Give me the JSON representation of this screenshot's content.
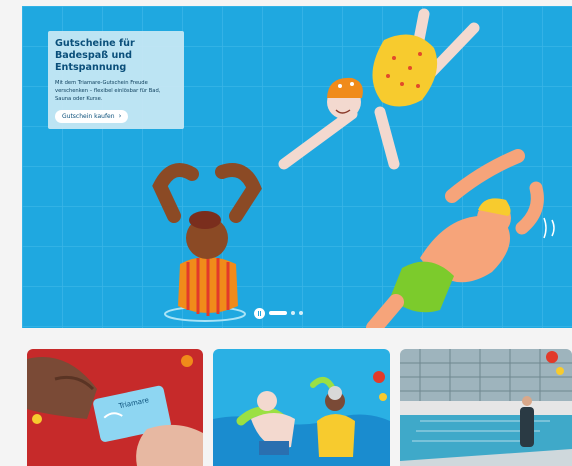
{
  "hero": {
    "title": "Gutscheine für Badespaß und Entspannung",
    "description": "Mit dem Triamare-Gutschein Freude verschenken – flexibel einlösbar für Bad, Sauna oder Kurse.",
    "cta_label": "Gutschein kaufen",
    "slides_total": 3,
    "slide_active": 1,
    "colors": {
      "water": "#1fa8e0",
      "infobox": "#c8e8f4",
      "heading": "#0a4f7a"
    },
    "icons": {
      "cta": "chevron-right-icon",
      "slider": "pause-icon"
    }
  },
  "cards": [
    {
      "name": "card-voucher-photo"
    },
    {
      "name": "card-aqua-fitness-illustration"
    },
    {
      "name": "card-indoor-pool-photo"
    }
  ]
}
